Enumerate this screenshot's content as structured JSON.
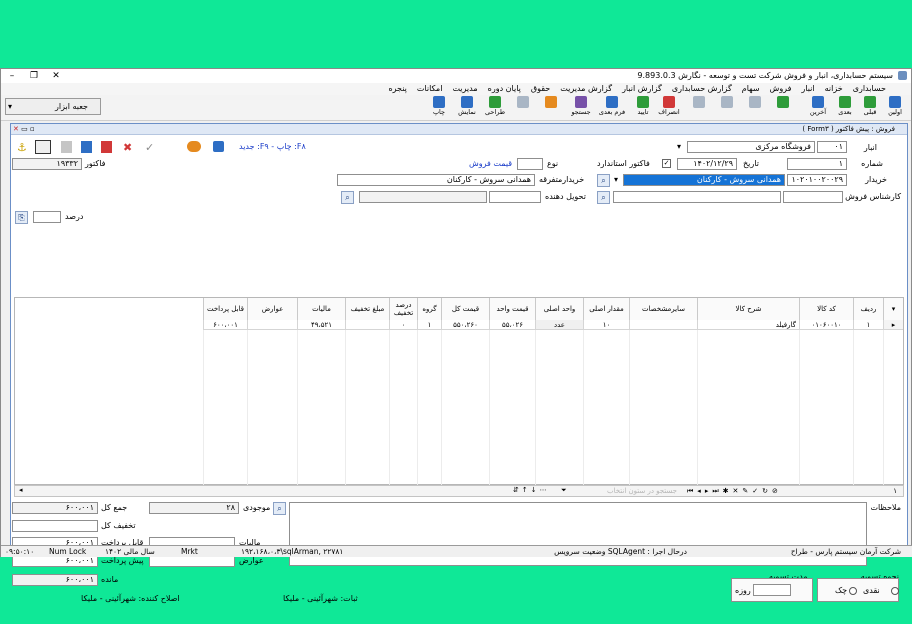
{
  "window": {
    "title": "سیستم حسابداری، انبار و فروش شرکت تست و توسعه - نگارش 9.893.0.3"
  },
  "menu": [
    "حسابداری",
    "خزانه",
    "انبار",
    "فروش",
    "سهام",
    "گزارش حسابداری",
    "گزارش انبار",
    "گزارش مدیریت",
    "حقوق",
    "پایان دوره",
    "مدیریت",
    "امکانات",
    "پنجره"
  ],
  "toolbar": {
    "buttons": [
      "اولین",
      "قبلی",
      "بعدی",
      "آخرین",
      "",
      "",
      "",
      "",
      "",
      "",
      "تایید",
      "انصراف",
      "فرم بعدی",
      "جستجو",
      "",
      "",
      "طراحی",
      "نمایش",
      "چاپ"
    ],
    "tool_box": "جعبه ابزار"
  },
  "child": {
    "title": "فروش : پیش فاکتور ( Form۳ )"
  },
  "header": {
    "mode_text": "F۸: چاپ - F۹: جدید",
    "factor_label": "فاکتور",
    "factor_number": "۱۹۳۳۲",
    "anbar_label": "انبار",
    "anbar_code": "۰۱",
    "anbar_name": "فروشگاه مرکزی",
    "number_label": "شماره",
    "number_value": "۱",
    "date_label": "تاریخ",
    "date_value": "۱۴۰۲/۱۲/۲۹",
    "standard_label": "فاکتور استاندارد",
    "type_label": "نوع",
    "price_type": "قیمت فروش",
    "buyer_label": "خریدار",
    "buyer_code": "۱۰۲۰۱۰۰۲۰۰۲۹",
    "buyer_name": "همدانی سروش - کارکنان",
    "misc_buyer_label": "خریدارمتفرقه",
    "misc_buyer_name": "همدانی سروش - کارکنان",
    "deliverer_label": "تحویل دهنده",
    "sales_expert_label": "کارشناس فروش",
    "percent_label": "درصد"
  },
  "grid": {
    "columns": [
      "ردیف",
      "کد کالا",
      "شرح کالا",
      "سایرمشخصات",
      "مقدار اصلی",
      "واحد اصلی",
      "قیمت واحد",
      "قیمت کل",
      "گروه",
      "درصد تخفیف",
      "مبلغ تخفیف",
      "مالیات",
      "عوارض",
      "قابل پرداخت"
    ],
    "rows": [
      {
        "row": "۱",
        "code": "۰۱۰۶۰۰۱۰",
        "desc": "گارفیلد",
        "other": "",
        "qty": "۱۰",
        "unit": "عدد",
        "unit_price": "۵۵،۰۲۶",
        "total": "۵۵۰،۲۶۰",
        "group": "۱",
        "disc_pct": "۰",
        "disc_amt": "",
        "tax": "۴۹،۵۲۱",
        "duty": "",
        "payable": "۶۰۰،۰۰۱"
      }
    ],
    "nav_row": "۱",
    "search_placeholder": "جستجو در ستون انتخاب"
  },
  "footer": {
    "notes_label": "ملاحظات",
    "stock_label": "موجودی",
    "stock_value": "۲۸",
    "sum_label": "جمع کل",
    "sum_value": "۶۰۰،۰۰۱",
    "total_disc_label": "تخفیف کل",
    "tax_label": "مالیات",
    "payable_label": "قابل پرداخت",
    "payable_value": "۶۰۰،۰۰۱",
    "duties_label": "عوارض",
    "prepay_label": "پیش پرداخت",
    "prepay_value": "۶۰۰،۰۰۱",
    "remain_label": "مانده",
    "remain_value": "۶۰۰،۰۰۱",
    "registrant": "ثبات: شهرآئینی - ملیکا",
    "editor": "اصلاح کننده: شهرآئینی - ملیکا",
    "settle_method_label": "نحوه تسویه",
    "cash_label": "نقدی",
    "check_label": "چک",
    "settle_period_label": "مدت تسویه",
    "day_label": "روزه"
  },
  "statusbar": {
    "company": "شرکت آرمان سیستم پارس - طراح",
    "sqlagent": "درحال اجرا : SQLAgent وضعیت سرویس",
    "server": "۱۹۲،۱۶۸،۰،۳\\sqlArman, ۲۲۷۸۱",
    "mrkt": "Mrkt",
    "fiscal": "سال مالی ۱۴۰۲",
    "numlock": "Num Lock",
    "time": "۰۹:۵۰:۱۰"
  },
  "colors": {
    "background": "#0fe897",
    "accent": "#1573d6",
    "link": "#1a3cc9"
  }
}
